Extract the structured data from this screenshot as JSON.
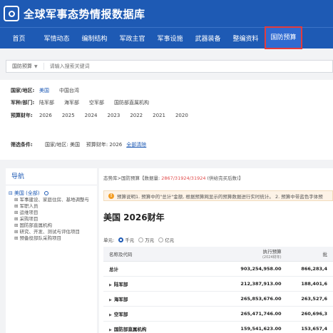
{
  "header": {
    "title": "全球军事态势情报数据库"
  },
  "nav": {
    "items": [
      "首页",
      "军情动态",
      "编制结构",
      "军政主官",
      "军事设施",
      "武器装备",
      "整编资料",
      "国防预算"
    ],
    "active_index": 7
  },
  "search": {
    "scope": "国防预算",
    "placeholder": "请输入搜索关键词"
  },
  "filters": {
    "country": {
      "label": "国家/地区:",
      "options": [
        "美国",
        "中国台湾"
      ],
      "selected": "美国"
    },
    "service": {
      "label": "军种/部门:",
      "options": [
        "陆军部",
        "海军部",
        "空军部",
        "国防部直属机构"
      ]
    },
    "year": {
      "label": "预算财年:",
      "options": [
        "2026",
        "2025",
        "2024",
        "2023",
        "2022",
        "2021",
        "2020"
      ]
    },
    "conditions": {
      "label": "筛选条件:",
      "text": "国家/地区: 美国    预算财年: 2026",
      "clear": "全部清除"
    }
  },
  "sidebar": {
    "title": "导航",
    "root": "美国 (全部)",
    "items": [
      "军事建设、家庭住房、基地调整与",
      "军职人员",
      "运维项目",
      "采购项目",
      "国防部直属机构",
      "研究、开发、测试与评估项目",
      "预备役部队采购项目"
    ]
  },
  "main": {
    "breadcrumb_prefix": "态势库>国防预算【数据量: ",
    "breadcrumb_count": "2867/31924/31924",
    "breadcrumb_suffix": " (供给完买后数)】",
    "notice": "预算说明1. 预算中的\"总计\"金额, 根据预算网显示的预算数据进行实时统计。 2. 预算中带蓝色字体预",
    "title": "美国 2026财年",
    "units": {
      "label": "单元:",
      "options": [
        "千元",
        "万元",
        "亿元"
      ],
      "selected": "千元"
    },
    "table": {
      "headers": [
        "名称及代码",
        "执行预算",
        "批"
      ],
      "header_sub": [
        "",
        "(2024财年)",
        ""
      ],
      "rows": [
        {
          "name": "总计",
          "exec": "903,254,958.00",
          "next": "866,283,4",
          "expand": false
        },
        {
          "name": "陆军部",
          "exec": "212,387,913.00",
          "next": "188,401,6",
          "expand": true
        },
        {
          "name": "海军部",
          "exec": "265,853,676.00",
          "next": "263,527,6",
          "expand": true
        },
        {
          "name": "空军部",
          "exec": "265,471,746.00",
          "next": "260,696,3",
          "expand": true
        },
        {
          "name": "国防部直属机构",
          "exec": "159,541,623.00",
          "next": "153,657,4",
          "expand": true
        }
      ]
    }
  }
}
